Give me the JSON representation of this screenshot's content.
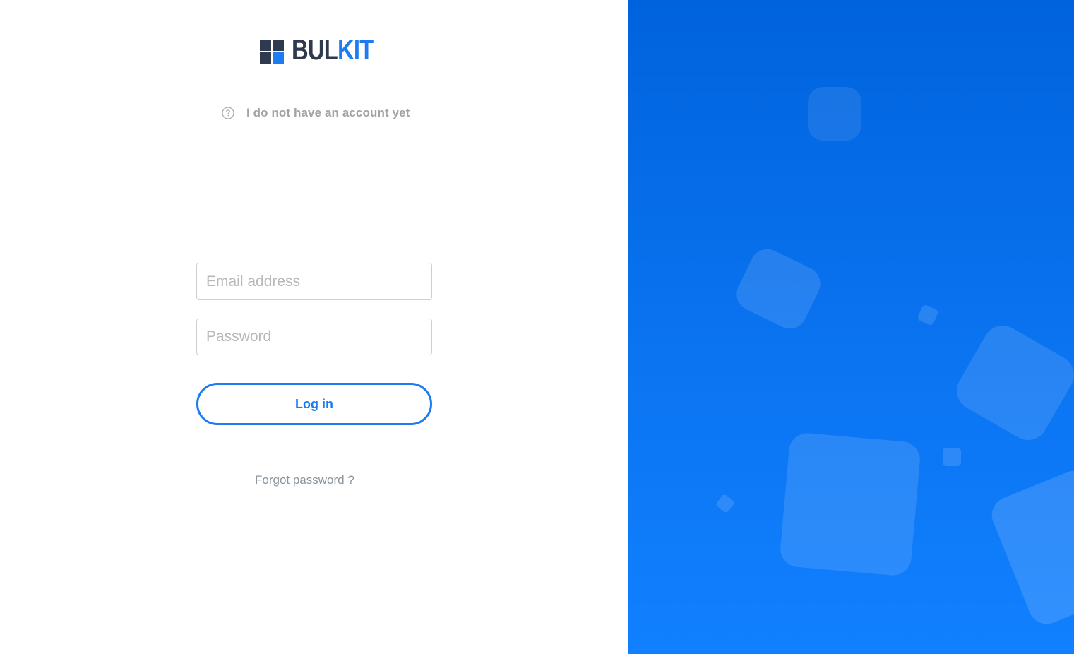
{
  "brand": {
    "name_part1": "BUL",
    "name_part2": "KIT",
    "color_dark": "#2f3a4f",
    "color_accent": "#1e7cf2"
  },
  "account_link": {
    "icon": "help-circle-icon",
    "label": "I do not have an account yet"
  },
  "form": {
    "email_placeholder": "Email address",
    "email_value": "",
    "password_placeholder": "Password",
    "password_value": "",
    "login_label": "Log in",
    "forgot_label": "Forgot password ?"
  },
  "hero": {
    "background_color_top": "#0063dd",
    "background_color_bottom": "#1180ff",
    "decoration": "floating-rounded-squares"
  }
}
